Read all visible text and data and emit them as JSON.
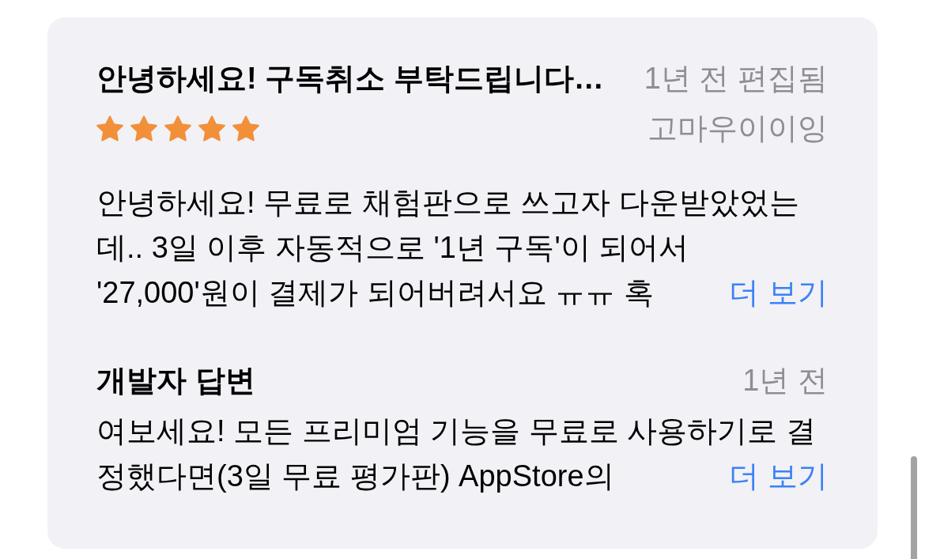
{
  "review": {
    "title": "안녕하세요! 구독취소 부탁드립니다…",
    "date": "1년 전 편집됨",
    "author": "고마우이이잉",
    "stars": 5,
    "body": "안녕하세요! 무료로 채험판으로 쓰고자 다운받았었는데.. 3일 이후 자동적으로 '1년 구독'이 되어서 '27,000'원이 결제가 되어버려서요 ㅠㅠ 혹",
    "more_link": "더 보기"
  },
  "developer_response": {
    "title": "개발자 답변",
    "date": "1년 전",
    "body": "여보세요! 모든 프리미엄 기능을 무료로 사용하기로 결정했다면(3일 무료 평가판) AppStore의",
    "more_link": "더 보기"
  }
}
